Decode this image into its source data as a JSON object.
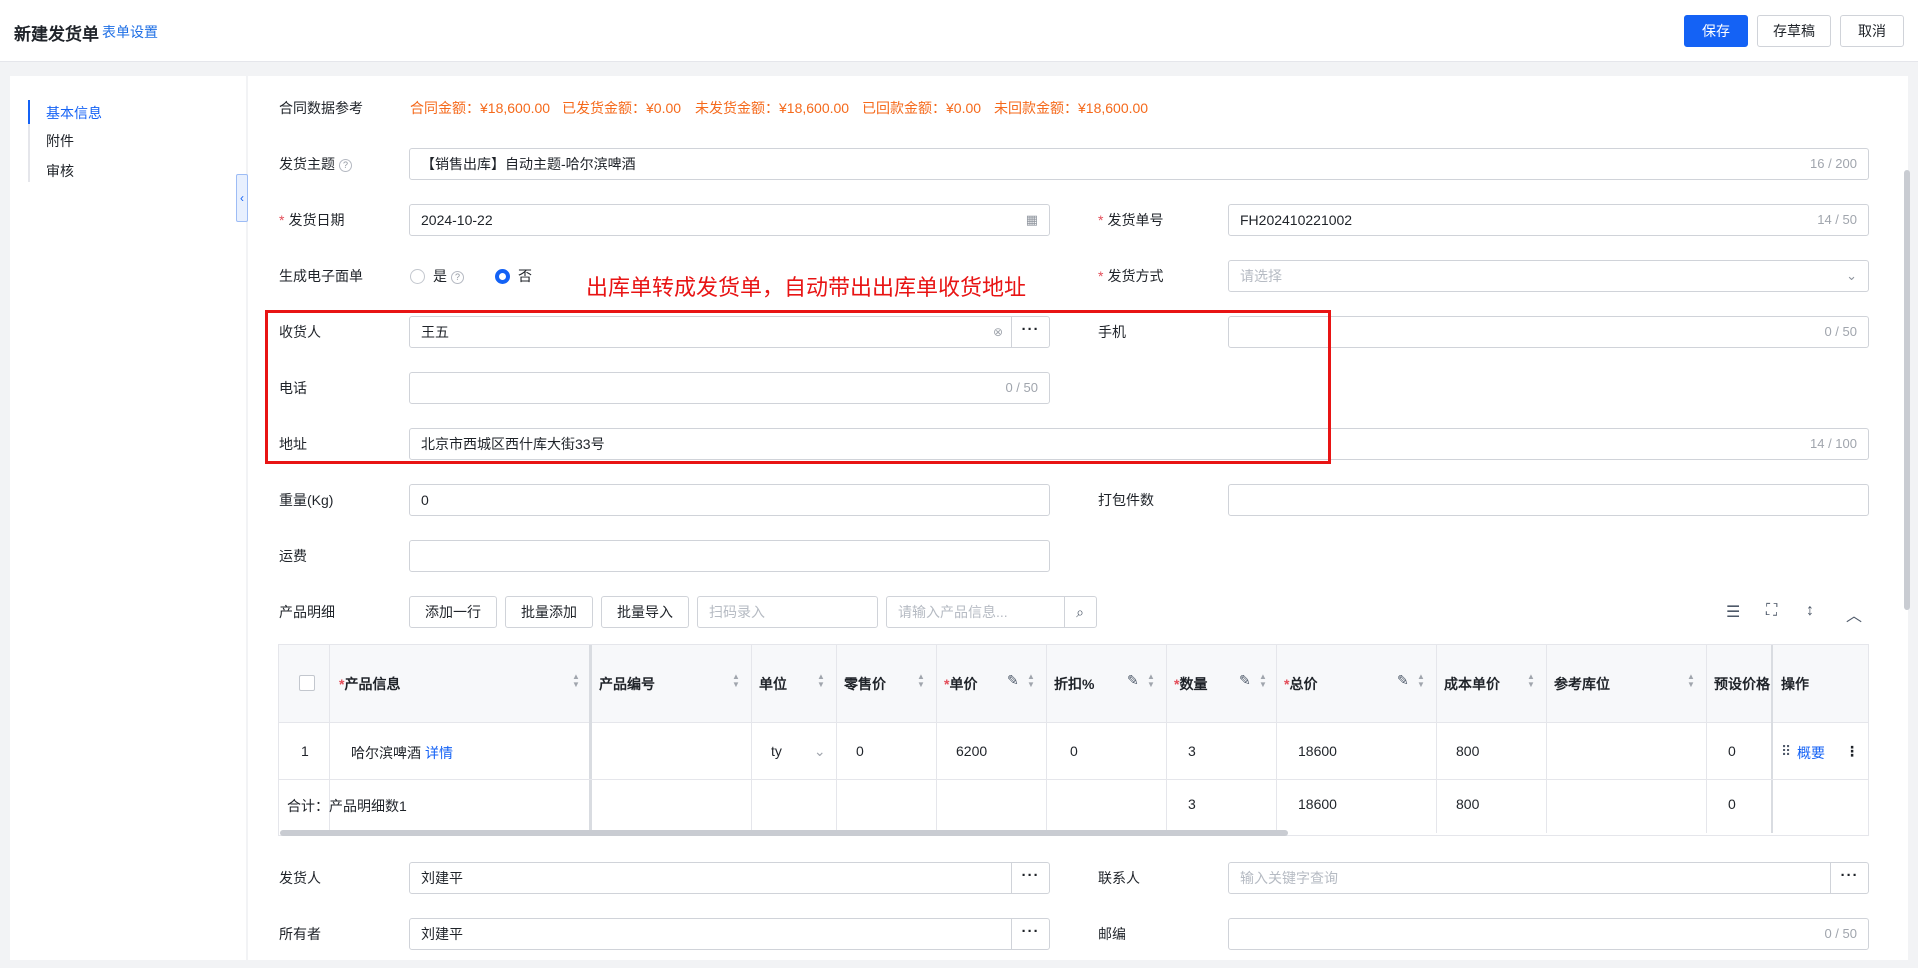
{
  "header": {
    "title": "新建发货单",
    "form_settings": "表单设置",
    "save": "保存",
    "draft": "存草稿",
    "cancel": "取消"
  },
  "sidebar": {
    "items": [
      {
        "label": "基本信息",
        "active": true
      },
      {
        "label": "附件",
        "active": false
      },
      {
        "label": "审核",
        "active": false
      }
    ]
  },
  "annotation": "出库单转成发货单，自动带出出库单收货地址",
  "form": {
    "contract_ref": {
      "label": "合同数据参考",
      "contract_amount": "合同金额：¥18,600.00",
      "shipped_amount": "已发货金额：¥0.00",
      "unshipped_amount": "未发货金额：¥18,600.00",
      "received_amount": "已回款金额：¥0.00",
      "unreceived_amount": "未回款金额：¥18,600.00"
    },
    "subject": {
      "label": "发货主题",
      "value": "【销售出库】自动主题-哈尔滨啤酒",
      "count": "16 / 200"
    },
    "ship_date": {
      "label": "发货日期",
      "value": "2024-10-22"
    },
    "ship_no": {
      "label": "发货单号",
      "value": "FH202410221002",
      "count": "14 / 50"
    },
    "e_waybill": {
      "label": "生成电子面单",
      "yes": "是",
      "no": "否",
      "selected": "否"
    },
    "ship_method": {
      "label": "发货方式",
      "placeholder": "请选择"
    },
    "receiver": {
      "label": "收货人",
      "value": "王五"
    },
    "mobile": {
      "label": "手机",
      "count": "0 / 50"
    },
    "phone": {
      "label": "电话",
      "count": "0 / 50"
    },
    "address": {
      "label": "地址",
      "value": "北京市西城区西什库大街33号",
      "count": "14 / 100"
    },
    "weight": {
      "label": "重量(Kg)",
      "value": "0"
    },
    "packages": {
      "label": "打包件数"
    },
    "freight": {
      "label": "运费"
    },
    "products": {
      "label": "产品明细",
      "add_row": "添加一行",
      "bulk_add": "批量添加",
      "bulk_import": "批量导入",
      "scan_placeholder": "扫码录入",
      "search_placeholder": "请输入产品信息..."
    },
    "shipper": {
      "label": "发货人",
      "value": "刘建平"
    },
    "contact": {
      "label": "联系人",
      "placeholder": "输入关键字查询"
    },
    "owner": {
      "label": "所有者",
      "value": "刘建平"
    },
    "postcode": {
      "label": "邮编",
      "count": "0 / 50"
    }
  },
  "table": {
    "columns": [
      "产品信息",
      "产品编号",
      "单位",
      "零售价",
      "单价",
      "折扣%",
      "数量",
      "总价",
      "成本单价",
      "参考库位",
      "预设价格",
      "操作"
    ],
    "rows": [
      {
        "index": "1",
        "product": "哈尔滨啤酒",
        "detail": "详情",
        "code": "",
        "unit": "ty",
        "retail": "0",
        "price": "6200",
        "discount": "0",
        "qty": "3",
        "total": "18600",
        "cost": "800",
        "location": "",
        "preset": "0",
        "summary": "概要"
      }
    ],
    "footer": {
      "label": "合计：产品明细数1",
      "qty": "3",
      "total": "18600",
      "cost": "800",
      "preset": "0"
    }
  }
}
